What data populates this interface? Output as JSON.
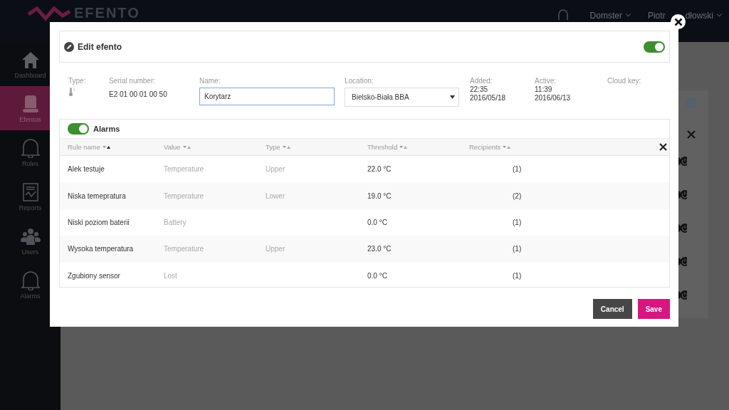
{
  "header": {
    "logo": "EFENTO",
    "company": "Domster",
    "user_start": "Piotr",
    "user_end": "dłowski"
  },
  "sidebar": {
    "items": [
      {
        "label": "Dashboard",
        "kind": "home",
        "selected": false
      },
      {
        "label": "Efentos",
        "kind": "device",
        "selected": true
      },
      {
        "label": "Rules",
        "kind": "bell",
        "selected": false
      },
      {
        "label": "Reports",
        "kind": "report",
        "selected": false
      },
      {
        "label": "Users",
        "kind": "users",
        "selected": false
      },
      {
        "label": "Alarms",
        "kind": "bell",
        "selected": false
      }
    ]
  },
  "modal": {
    "title": "Edit efento",
    "enabled": true,
    "fields": {
      "type_label": "Type:",
      "serial_label": "Serial number:",
      "serial": "E2 01 00 01 00 50",
      "name_label": "Name:",
      "name": "Korytarz",
      "location_label": "Location:",
      "location": "Bielsko-Biała BBA",
      "added_label": "Added:",
      "added_time": "22:35",
      "added_date": "2016/05/18",
      "active_label": "Active:",
      "active_time": "11:39",
      "active_date": "2016/06/13",
      "cloud_key_label": "Cloud key:"
    },
    "alarms": {
      "title": "Alarms",
      "on": true,
      "columns": [
        {
          "label": "Rule name",
          "sorted": true
        },
        {
          "label": "Value",
          "sorted": false
        },
        {
          "label": "Type",
          "sorted": false
        },
        {
          "label": "Threshold",
          "sorted": false
        },
        {
          "label": "Recipients",
          "sorted": false
        }
      ],
      "rows": [
        {
          "rule_name": "Alek testuje",
          "value": "Temperature",
          "type": "Upper",
          "threshold": "22.0 °C",
          "recipients": "(1)"
        },
        {
          "rule_name": "Niska temepratura",
          "value": "Temperature",
          "type": "Lower",
          "threshold": "19.0 °C",
          "recipients": "(2)"
        },
        {
          "rule_name": "Niski poziom baterii",
          "value": "Battery",
          "threshold": "0.0 °C",
          "recipients": "(1)"
        },
        {
          "rule_name": "Wysoka temperatura",
          "value": "Temperature",
          "type": "Upper",
          "threshold": "23.0 °C",
          "recipients": "(1)"
        },
        {
          "rule_name": "Zgubiony sensor",
          "value": "Lost",
          "threshold": "0.0 °C",
          "recipients": "(1)"
        }
      ]
    },
    "buttons": [
      {
        "label": "Cancel",
        "kind": "secondary"
      },
      {
        "label": "Save",
        "kind": "primary"
      }
    ]
  }
}
